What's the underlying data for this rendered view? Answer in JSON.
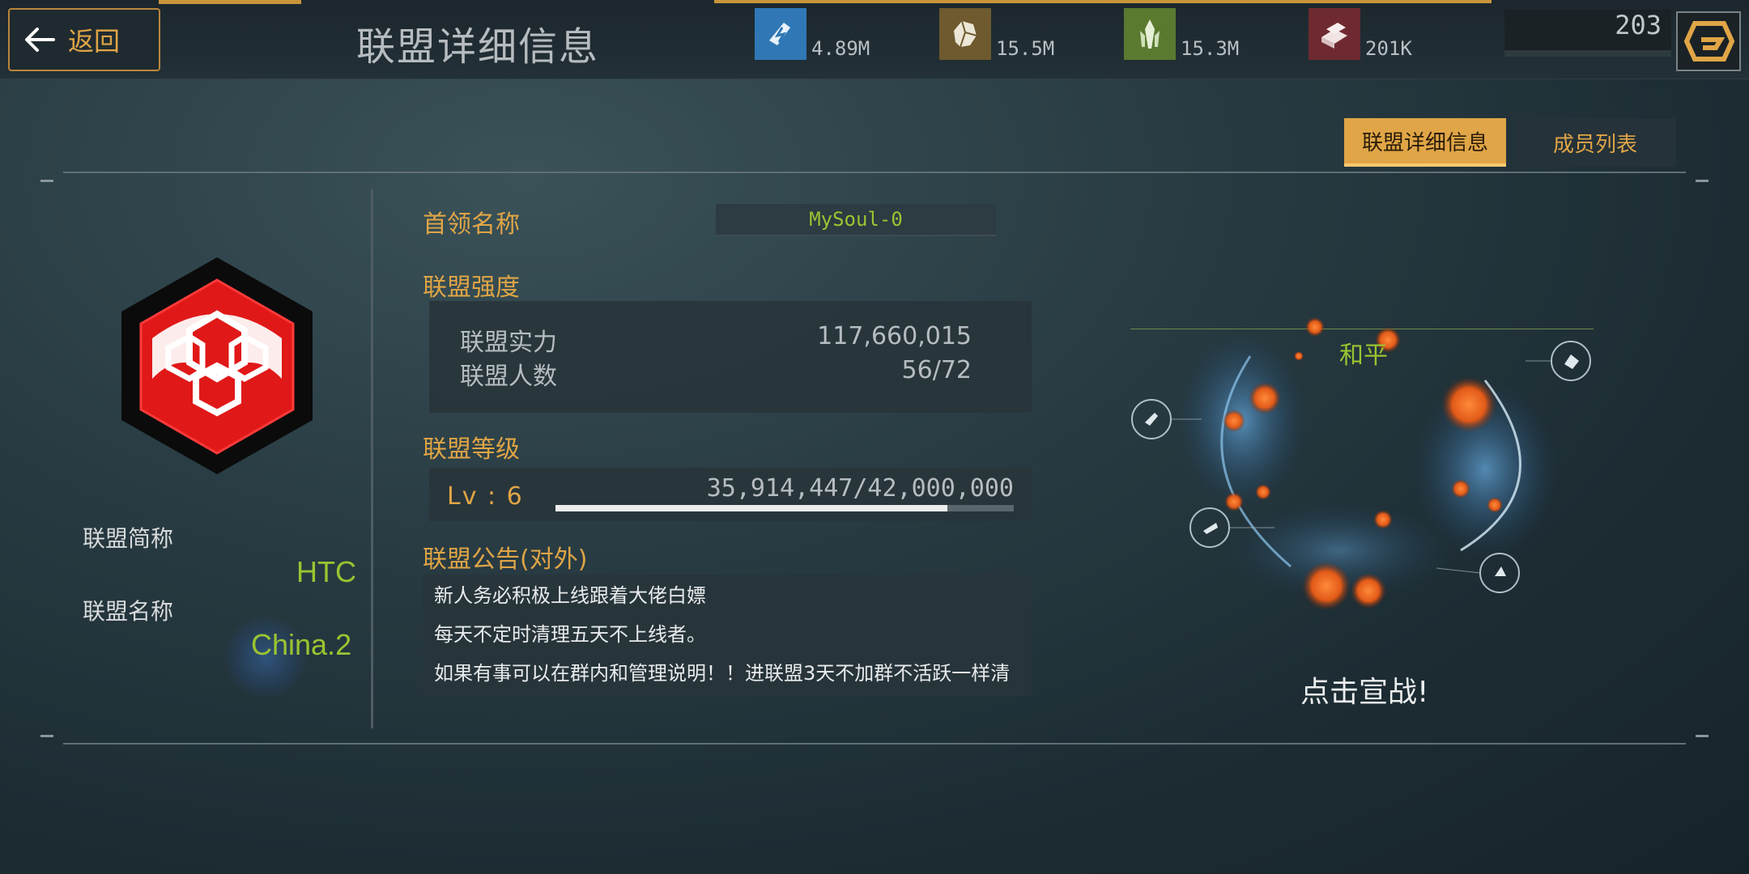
{
  "header": {
    "back_label": "返回",
    "title": "联盟详细信息"
  },
  "resources": [
    {
      "icon": "energy-icon",
      "value": "4.89M",
      "color": "#2f78b5"
    },
    {
      "icon": "ore-icon",
      "value": "15.5M",
      "color": "#6e5a2e"
    },
    {
      "icon": "crystal-icon",
      "value": "15.3M",
      "color": "#5a7a30"
    },
    {
      "icon": "alloy-icon",
      "value": "201K",
      "color": "#6e2a30"
    }
  ],
  "power": {
    "value": "203"
  },
  "tabs": [
    {
      "label": "联盟详细信息",
      "active": true
    },
    {
      "label": "成员列表",
      "active": false
    }
  ],
  "alliance": {
    "short_name_label": "联盟简称",
    "short_name": "HTC",
    "name_label": "联盟名称",
    "name": "China.2",
    "leader_label": "首领名称",
    "leader": "MySoul-0",
    "strength_title": "联盟强度",
    "power_label": "联盟实力",
    "power_value": "117,660,015",
    "members_label": "联盟人数",
    "members_value": "56/72",
    "level_title": "联盟等级",
    "level": "Lv : 6",
    "exp_text": "35,914,447/42,000,000",
    "exp_fraction": 0.855,
    "notice_title": "联盟公告(对外)",
    "notice_lines": [
      "新人务必积极上线跟着大佬白嫖",
      "每天不定时清理五天不上线者。",
      "如果有事可以在群内和管理说明！！进联盟3天不加群不活跃一样清"
    ],
    "relation": "和平",
    "declare_war": "点击宣战!"
  },
  "colors": {
    "accent": "#e0a546",
    "green": "#9bc431",
    "emblem_red": "#e01818"
  }
}
